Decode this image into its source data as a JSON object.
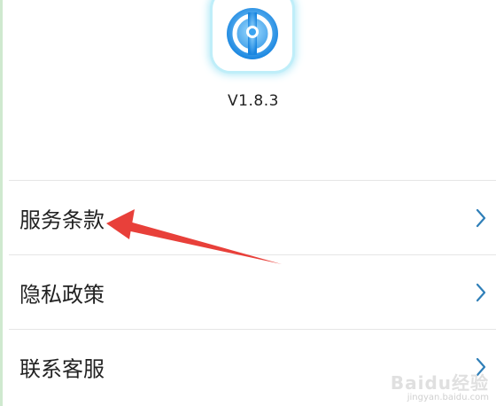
{
  "app": {
    "logo_icon": "app-logo-icon",
    "version": "V1.8.3"
  },
  "menu": {
    "items": [
      {
        "label": "服务条款",
        "icon": "chevron-right-icon"
      },
      {
        "label": "隐私政策",
        "icon": "chevron-right-icon"
      },
      {
        "label": "联系客服",
        "icon": "chevron-right-icon"
      }
    ]
  },
  "annotation": {
    "arrow_color": "#e8403a",
    "points_to": "服务条款"
  },
  "watermark": {
    "brand": "Baidu经验",
    "url": "jingyan.baidu.com"
  },
  "colors": {
    "accent": "#1e8fe6",
    "chevron": "#2f7fb8",
    "divider": "#e6e6e6"
  }
}
